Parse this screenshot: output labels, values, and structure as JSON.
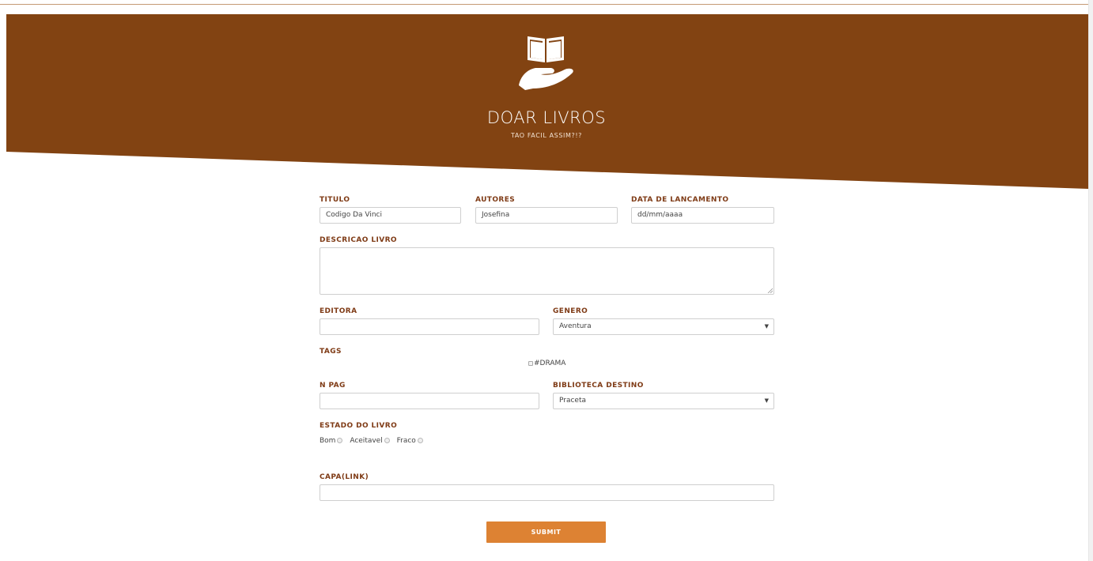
{
  "colors": {
    "banner": "#824312",
    "accent": "#dd8233",
    "label": "#7f3b16"
  },
  "banner": {
    "logo_icon": "book-in-hand-icon",
    "title": "DOAR LIVROS",
    "subtitle": "TAO FACIL ASSIM?!?"
  },
  "form": {
    "titulo": {
      "label": "TITULO",
      "value": "Codigo Da Vinci"
    },
    "autores": {
      "label": "AUTORES",
      "value": "Josefina"
    },
    "data": {
      "label": "DATA DE LANCAMENTO",
      "placeholder": "dd/mm/aaaa"
    },
    "descricao": {
      "label": "DESCRICAO LIVRO",
      "value": ""
    },
    "editora": {
      "label": "EDITORA",
      "value": ""
    },
    "genero": {
      "label": "GENERO",
      "selected": "Aventura"
    },
    "tags": {
      "label": "TAGS",
      "items": [
        "#DRAMA"
      ]
    },
    "npag": {
      "label": "N PAG",
      "value": ""
    },
    "biblioteca": {
      "label": "BIBLIOTECA DESTINO",
      "selected": "Praceta"
    },
    "estado": {
      "label": "ESTADO DO LIVRO",
      "options": [
        "Bom",
        "Aceitavel",
        "Fraco"
      ]
    },
    "capa": {
      "label": "CAPA(LINK)",
      "value": ""
    },
    "submit_label": "SUBMIT"
  }
}
